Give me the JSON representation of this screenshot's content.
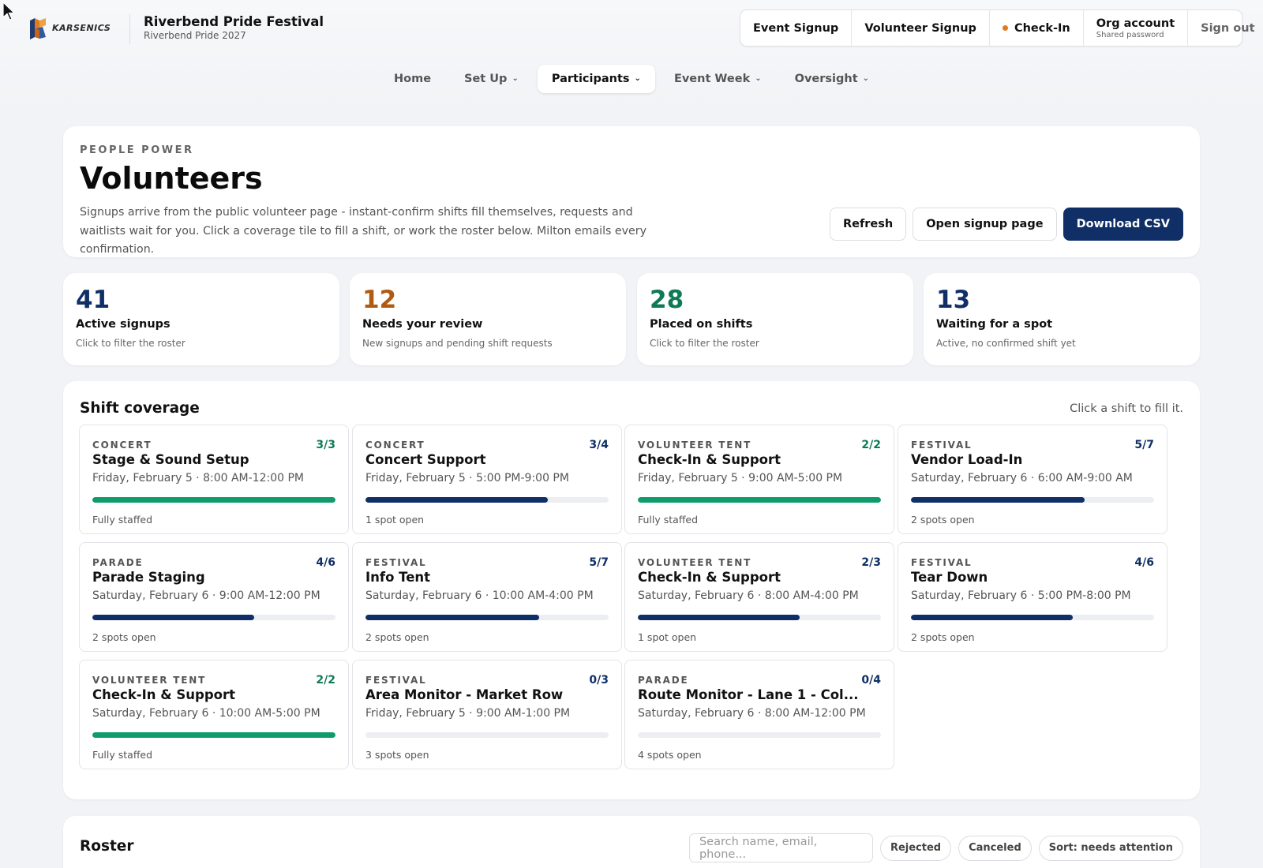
{
  "colors": {
    "navy": "#0f2f66",
    "green": "#0f9b6a",
    "orange": "#b05a12",
    "teal": "#0f7a56",
    "accent_dot": "#e07a1f"
  },
  "brand": {
    "logo_text": "KARSENICS",
    "title": "Riverbend Pride Festival",
    "subtitle": "Riverbend Pride 2027"
  },
  "top_actions": {
    "event_signup": "Event Signup",
    "volunteer_signup": "Volunteer Signup",
    "check_in": "Check-In",
    "org_account": "Org account",
    "org_account_sub": "Shared password",
    "sign_out": "Sign out"
  },
  "nav": [
    {
      "label": "Home",
      "dropdown": false,
      "active": false
    },
    {
      "label": "Set Up",
      "dropdown": true,
      "active": false
    },
    {
      "label": "Participants",
      "dropdown": true,
      "active": true
    },
    {
      "label": "Event Week",
      "dropdown": true,
      "active": false
    },
    {
      "label": "Oversight",
      "dropdown": true,
      "active": false
    }
  ],
  "hero": {
    "eyebrow": "PEOPLE POWER",
    "title": "Volunteers",
    "description": "Signups arrive from the public volunteer page - instant-confirm shifts fill themselves, requests and waitlists wait for you. Click a coverage tile to fill a shift, or work the roster below. Milton emails every confirmation.",
    "refresh": "Refresh",
    "open_signup": "Open signup page",
    "download_csv": "Download CSV"
  },
  "stats": [
    {
      "value": "41",
      "label": "Active signups",
      "hint": "Click to filter the roster",
      "color": "#0f2f66"
    },
    {
      "value": "12",
      "label": "Needs your review",
      "hint": "New signups and pending shift requests",
      "color": "#b05a12"
    },
    {
      "value": "28",
      "label": "Placed on shifts",
      "hint": "Click to filter the roster",
      "color": "#0f7a56"
    },
    {
      "value": "13",
      "label": "Waiting for a spot",
      "hint": "Active, no confirmed shift yet",
      "color": "#0f2f66"
    }
  ],
  "coverage": {
    "title": "Shift coverage",
    "hint": "Click a shift to fill it.",
    "shifts": [
      {
        "category": "CONCERT",
        "name": "Stage & Sound Setup",
        "when": "Friday, February 5 · 8:00 AM-12:00 PM",
        "filled": 3,
        "total": 3,
        "count": "3/3",
        "status": "Fully staffed"
      },
      {
        "category": "CONCERT",
        "name": "Concert Support",
        "when": "Friday, February 5 · 5:00 PM-9:00 PM",
        "filled": 3,
        "total": 4,
        "count": "3/4",
        "status": "1 spot open"
      },
      {
        "category": "VOLUNTEER TENT",
        "name": "Check-In & Support",
        "when": "Friday, February 5 · 9:00 AM-5:00 PM",
        "filled": 2,
        "total": 2,
        "count": "2/2",
        "status": "Fully staffed"
      },
      {
        "category": "FESTIVAL",
        "name": "Vendor Load-In",
        "when": "Saturday, February 6 · 6:00 AM-9:00 AM",
        "filled": 5,
        "total": 7,
        "count": "5/7",
        "status": "2 spots open"
      },
      {
        "category": "PARADE",
        "name": "Parade Staging",
        "when": "Saturday, February 6 · 9:00 AM-12:00 PM",
        "filled": 4,
        "total": 6,
        "count": "4/6",
        "status": "2 spots open"
      },
      {
        "category": "FESTIVAL",
        "name": "Info Tent",
        "when": "Saturday, February 6 · 10:00 AM-4:00 PM",
        "filled": 5,
        "total": 7,
        "count": "5/7",
        "status": "2 spots open"
      },
      {
        "category": "VOLUNTEER TENT",
        "name": "Check-In & Support",
        "when": "Saturday, February 6 · 8:00 AM-4:00 PM",
        "filled": 2,
        "total": 3,
        "count": "2/3",
        "status": "1 spot open"
      },
      {
        "category": "FESTIVAL",
        "name": "Tear Down",
        "when": "Saturday, February 6 · 5:00 PM-8:00 PM",
        "filled": 4,
        "total": 6,
        "count": "4/6",
        "status": "2 spots open"
      },
      {
        "category": "VOLUNTEER TENT",
        "name": "Check-In & Support",
        "when": "Saturday, February 6 · 10:00 AM-5:00 PM",
        "filled": 2,
        "total": 2,
        "count": "2/2",
        "status": "Fully staffed"
      },
      {
        "category": "FESTIVAL",
        "name": "Area Monitor - Market Row",
        "when": "Friday, February 5 · 9:00 AM-1:00 PM",
        "filled": 0,
        "total": 3,
        "count": "0/3",
        "status": "3 spots open"
      },
      {
        "category": "PARADE",
        "name": "Route Monitor - Lane 1 - Col...",
        "when": "Saturday, February 6 · 8:00 AM-12:00 PM",
        "filled": 0,
        "total": 4,
        "count": "0/4",
        "status": "4 spots open"
      }
    ]
  },
  "roster": {
    "title": "Roster",
    "search_placeholder": "Search name, email, phone...",
    "filters": [
      "Rejected",
      "Canceled",
      "Sort: needs attention"
    ]
  }
}
